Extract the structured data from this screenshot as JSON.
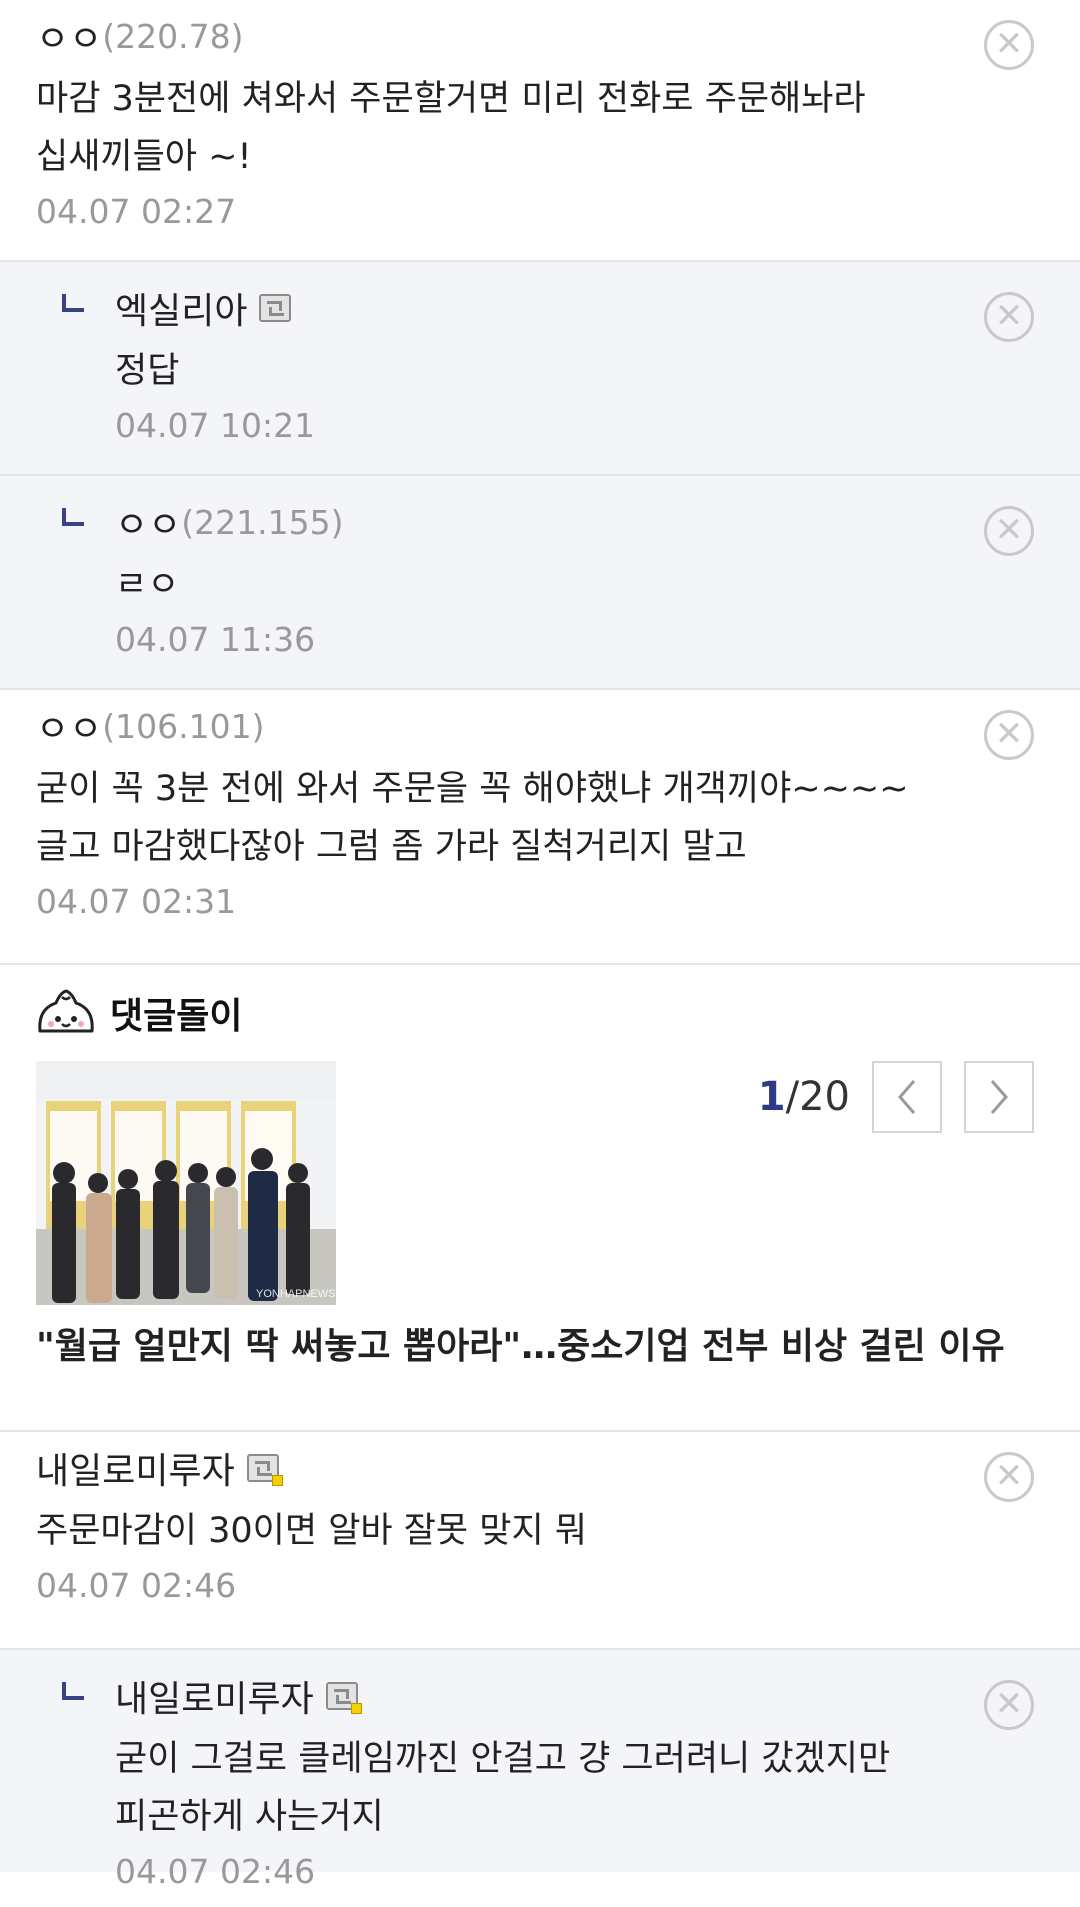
{
  "comments": [
    {
      "author": "ㅇㅇ",
      "ip": "(220.78)",
      "text": "마감 3분전에 쳐와서 주문할거면 미리 전화로 주문해놔라 십새끼들아 ~!",
      "date": "04.07 02:27"
    },
    {
      "author": "엑실리아",
      "text": "정답",
      "date": "04.07 10:21"
    },
    {
      "author": "ㅇㅇ",
      "ip": "(221.155)",
      "text": "ㄹㅇ",
      "date": "04.07 11:36"
    },
    {
      "author": "ㅇㅇ",
      "ip": "(106.101)",
      "text": "굳이 꼭 3분 전에 와서 주문을 꼭 해야했냐 개객끼야~~~~ 글고 마감했다잖아 그럼 좀 가라 질척거리지 말고",
      "date": "04.07 02:31"
    }
  ],
  "bot": {
    "title": "댓글돌이",
    "page_current": "1",
    "page_total": "/20",
    "headline": "\"월급 얼만지 딱 써놓고 뽑아라\"…중소기업 전부 비상 걸린 이유",
    "watermark": "YONHAPNEWS"
  },
  "comments2": [
    {
      "author": "내일로미루자",
      "text": "주문마감이 30이면 알바 잘못 맞지 뭐",
      "date": "04.07 02:46"
    },
    {
      "author": "내일로미루자",
      "text": "굳이 그걸로 클레임까진 안걸고 걍 그러려니 갔겠지만 피곤하게 사는거지",
      "date": "04.07 02:46"
    }
  ],
  "icons": {
    "delete": "close-circle-icon",
    "reply": "reply-arrow-icon",
    "badge": "gallery-member-badge-icon"
  },
  "colors": {
    "accent": "#2d3a85",
    "reply_bg": "#f4f5f8",
    "meta": "#999999"
  }
}
